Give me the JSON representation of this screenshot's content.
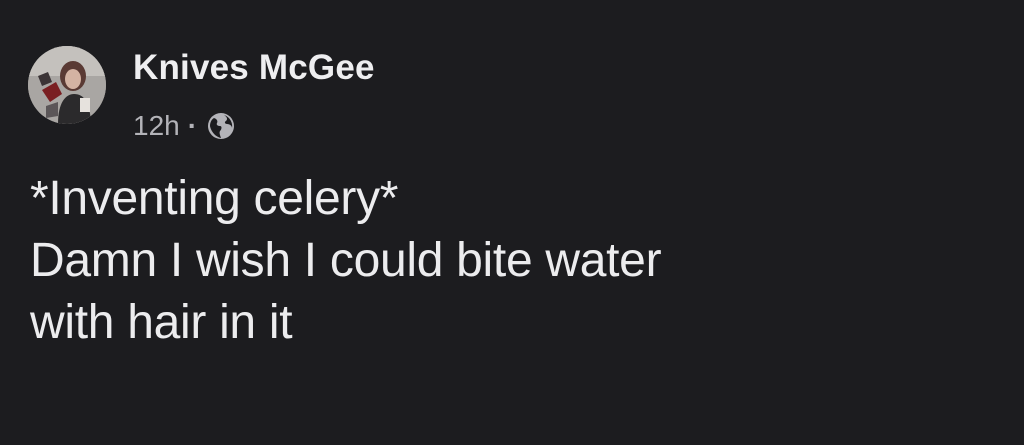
{
  "post": {
    "author": "Knives McGee",
    "timestamp": "12h",
    "separator": "·",
    "privacy_icon": "globe-icon",
    "avatar_icon": "profile-photo",
    "text_lines": [
      "*Inventing celery*",
      "Damn I wish I could bite water",
      "with hair in it"
    ]
  },
  "colors": {
    "background": "#1c1c1f",
    "primary_text": "#ececee",
    "secondary_text": "#b3b3b8"
  }
}
